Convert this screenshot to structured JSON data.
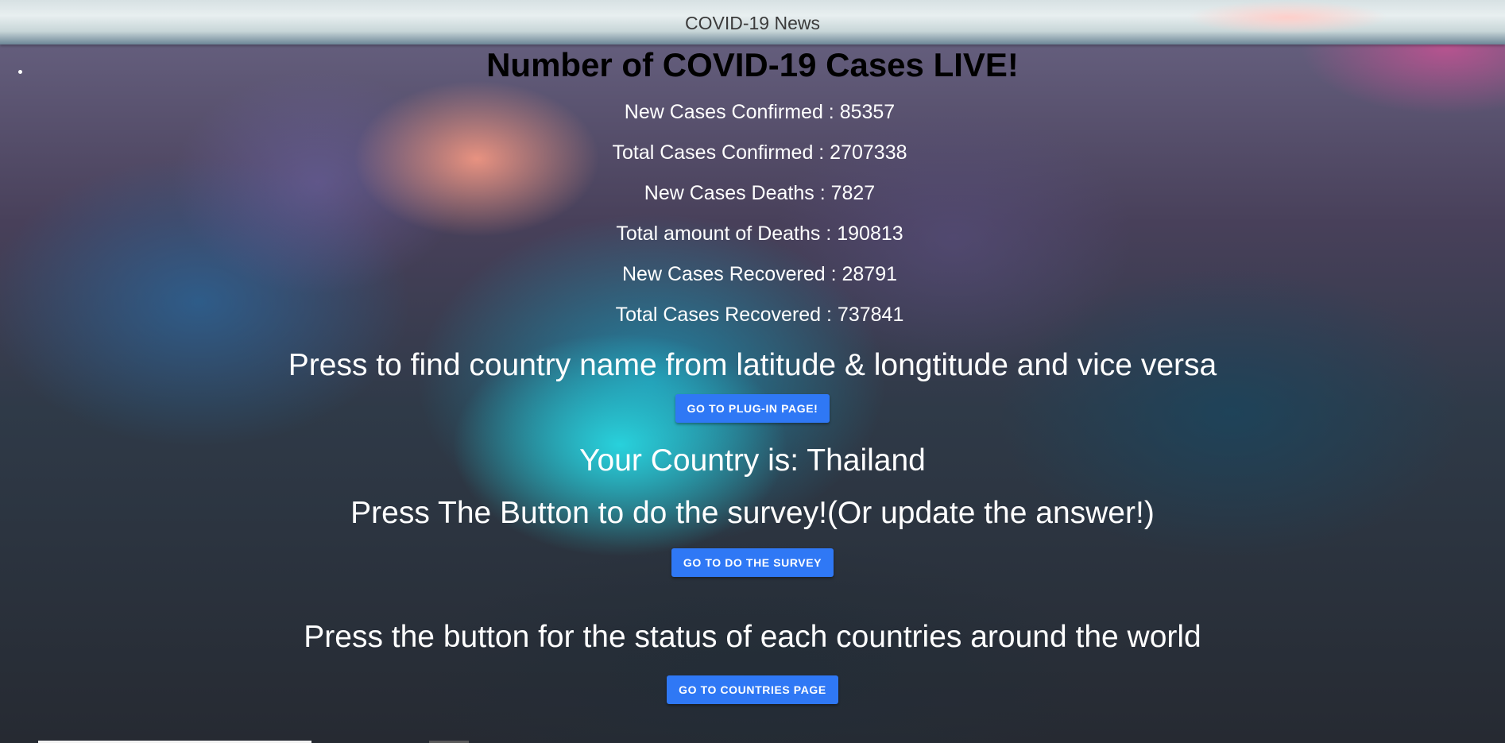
{
  "header": {
    "title": "COVID-19 News"
  },
  "main": {
    "title": "Number of COVID-19 Cases LIVE!",
    "stats": [
      "New Cases Confirmed : 85357",
      "Total Cases Confirmed : 2707338",
      "New Cases Deaths : 7827",
      "Total amount of Deaths : 190813",
      "New Cases Recovered : 28791",
      "Total Cases Recovered : 737841"
    ],
    "plugin_prompt": "Press to find country name from latitude & longtitude and vice versa",
    "plugin_button": "GO TO PLUG-IN PAGE!",
    "country": "Your Country is: Thailand",
    "survey_prompt": "Press The Button to do the survey!(Or update the answer!)",
    "survey_button": "GO TO DO THE SURVEY",
    "world_prompt": "Press the button for the status of each countries around the world",
    "countries_button": "GO TO COUNTRIES PAGE"
  },
  "colors": {
    "button": "#2f78f5",
    "title": "#000000",
    "text": "#ffffff"
  }
}
